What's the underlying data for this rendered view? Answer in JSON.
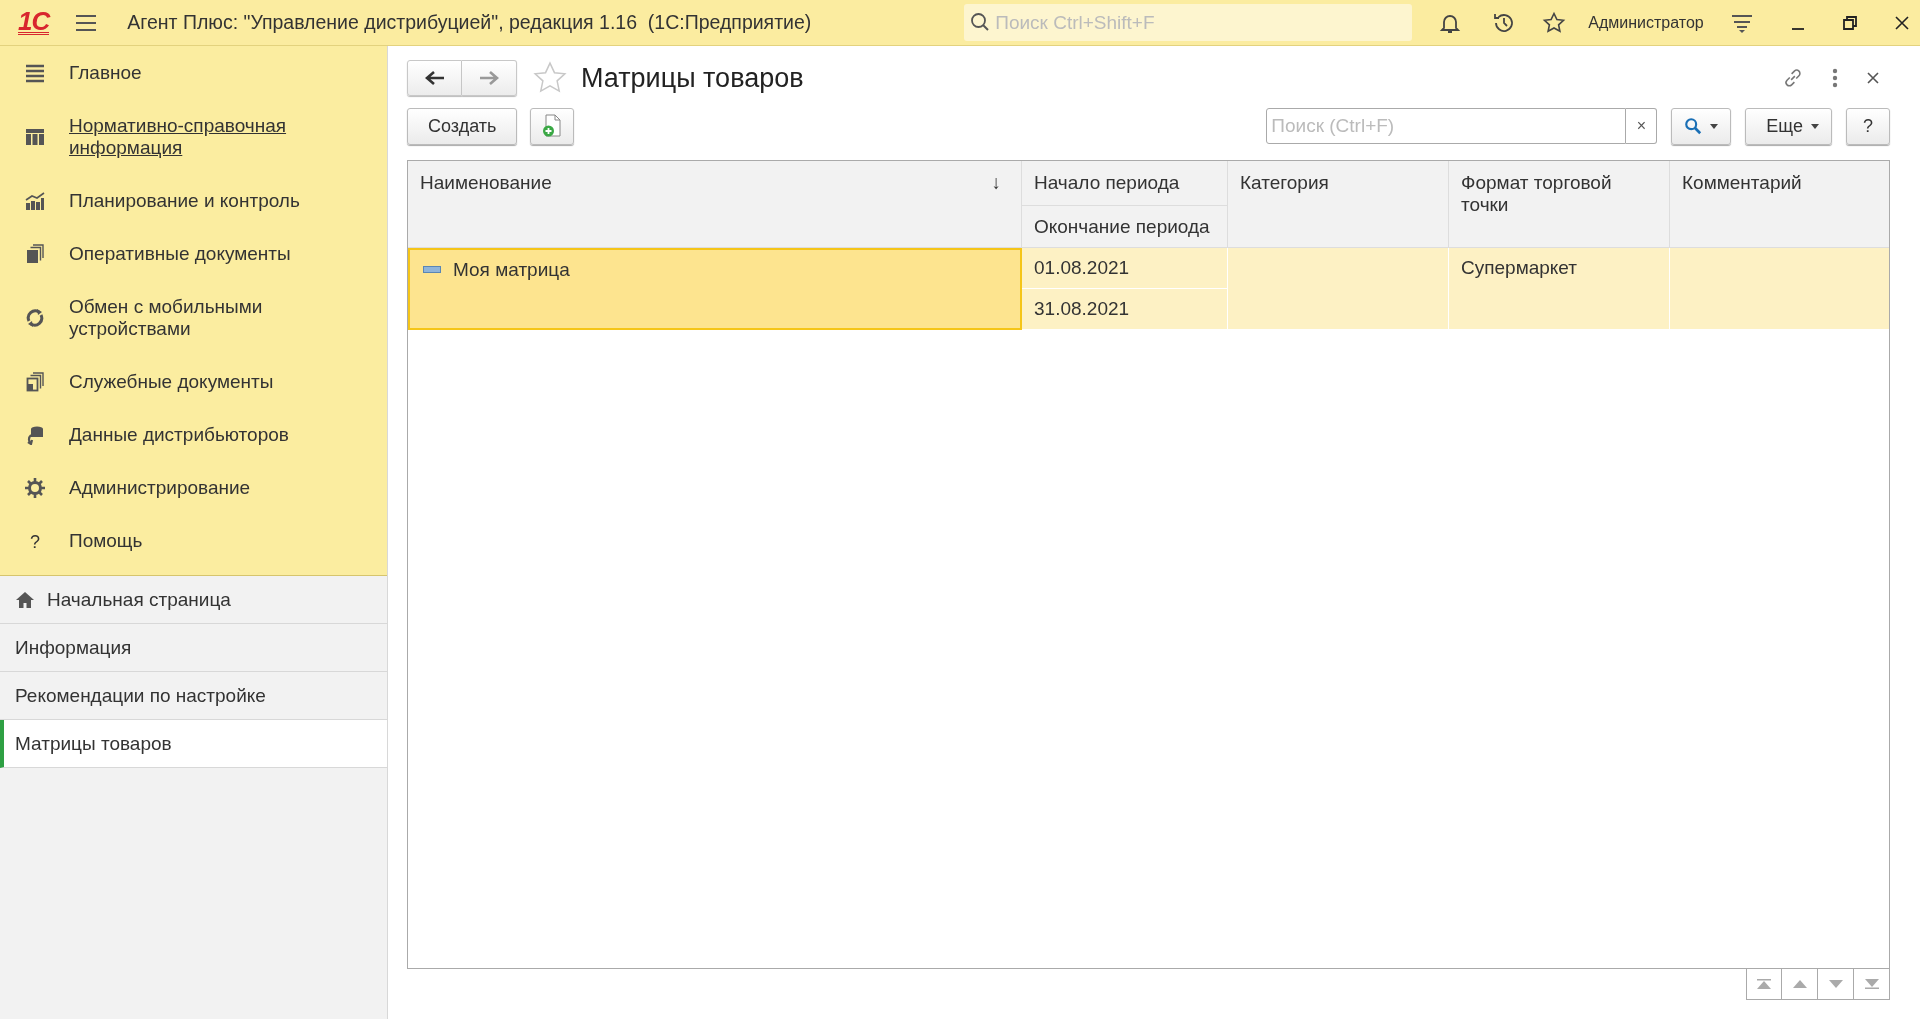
{
  "app_bar": {
    "logo": "1С",
    "title": "Агент Плюс: \"Управление дистрибуцией\", редакция 1.16  (1С:Предприятие)",
    "search": {
      "placeholder": "Поиск Ctrl+Shift+F"
    },
    "user": "Администратор"
  },
  "sections": [
    {
      "label": "Главное",
      "underlined": false
    },
    {
      "label": "Нормативно-справочная информация",
      "underlined": true
    },
    {
      "label": "Планирование и контроль",
      "underlined": false
    },
    {
      "label": "Оперативные документы",
      "underlined": false
    },
    {
      "label": "Обмен с мобильными устройствами",
      "underlined": false
    },
    {
      "label": "Служебные документы",
      "underlined": false
    },
    {
      "label": "Данные дистрибьюторов",
      "underlined": false
    },
    {
      "label": "Администрирование",
      "underlined": false
    },
    {
      "label": "Помощь",
      "underlined": false,
      "icon_text": "?"
    }
  ],
  "open_pages": [
    {
      "label": "Начальная страница",
      "kind": "home",
      "selected": false
    },
    {
      "label": "Информация",
      "kind": "page",
      "selected": false
    },
    {
      "label": "Рекомендации по настройке",
      "kind": "page",
      "selected": false
    },
    {
      "label": "Матрицы товаров",
      "kind": "page",
      "selected": true
    }
  ],
  "form": {
    "title": "Матрицы товаров",
    "back_enabled": true,
    "forward_enabled": false,
    "favorite": false,
    "toolbar": {
      "create": "Создать",
      "search": {
        "placeholder": "Поиск (Ctrl+F)",
        "clear": "×"
      },
      "more": "Еще",
      "help": "?"
    },
    "table": {
      "columns": [
        {
          "label": "Наименование",
          "sort_mark": "↓"
        },
        {
          "label": "Начало периода",
          "sub_label": "Окончание периода"
        },
        {
          "label": "Категория"
        },
        {
          "label": "Формат торговой точки"
        },
        {
          "label": "Комментарий"
        }
      ],
      "rows": [
        {
          "name": "Моя матрица",
          "start": "01.08.2021",
          "end": "31.08.2021",
          "format": "Супермаркет",
          "selected": true
        }
      ]
    }
  }
}
